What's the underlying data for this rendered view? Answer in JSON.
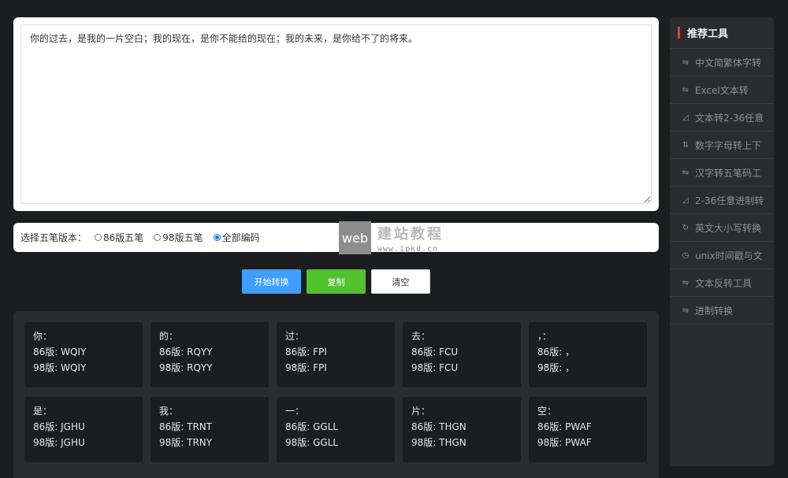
{
  "input": {
    "text": "你的过去，是我的一片空白；我的现在，是你不能给的现在；我的未来，是你给不了的将来。"
  },
  "version": {
    "label": "选择五笔版本：",
    "options": [
      {
        "label": "86版五笔",
        "checked": false
      },
      {
        "label": "98版五笔",
        "checked": false
      },
      {
        "label": "全部编码",
        "checked": true
      }
    ]
  },
  "watermark": {
    "box": "web",
    "title": "建站教程",
    "url": "www.ipkd.cn"
  },
  "buttons": {
    "convert": "开始转换",
    "copy": "复制",
    "clear": "清空"
  },
  "results": [
    {
      "char": "你：",
      "v86": "86版: WQIY",
      "v98": "98版: WQIY"
    },
    {
      "char": "的：",
      "v86": "86版: RQYY",
      "v98": "98版: RQYY"
    },
    {
      "char": "过：",
      "v86": "86版: FPI",
      "v98": "98版: FPI"
    },
    {
      "char": "去：",
      "v86": "86版: FCU",
      "v98": "98版: FCU"
    },
    {
      "char": "，：",
      "v86": "86版: ，",
      "v98": "98版: ，"
    },
    {
      "char": "是：",
      "v86": "86版: JGHU",
      "v98": "98版: JGHU"
    },
    {
      "char": "我：",
      "v86": "86版: TRNT",
      "v98": "98版: TRNY"
    },
    {
      "char": "一：",
      "v86": "86版: GGLL",
      "v98": "98版: GGLL"
    },
    {
      "char": "片：",
      "v86": "86版: THGN",
      "v98": "98版: THGN"
    },
    {
      "char": "空：",
      "v86": "86版: PWAF",
      "v98": "98版: PWAF"
    }
  ],
  "sidebar": {
    "title": "推荐工具",
    "items": [
      {
        "label": "中文简繁体字转",
        "icon": "swap-icon",
        "glyph": "⇋"
      },
      {
        "label": "Excel文本转",
        "icon": "swap-icon",
        "glyph": "⇋"
      },
      {
        "label": "文本转2-36任意",
        "icon": "chart-icon",
        "glyph": "◿"
      },
      {
        "label": "数字字母转上下",
        "icon": "sort-icon",
        "glyph": "⇅"
      },
      {
        "label": "汉字转五笔码工",
        "icon": "swap-icon",
        "glyph": "⇋"
      },
      {
        "label": "2-36任意进制转",
        "icon": "chart-icon",
        "glyph": "◿"
      },
      {
        "label": "英文大小写转换",
        "icon": "refresh-icon",
        "glyph": "↻"
      },
      {
        "label": "unix时间戳与文",
        "icon": "clock-icon",
        "glyph": "◷"
      },
      {
        "label": "文本反转工具",
        "icon": "swap-icon",
        "glyph": "⇋"
      },
      {
        "label": "进制转换",
        "icon": "swap-icon",
        "glyph": "⇋"
      }
    ]
  }
}
